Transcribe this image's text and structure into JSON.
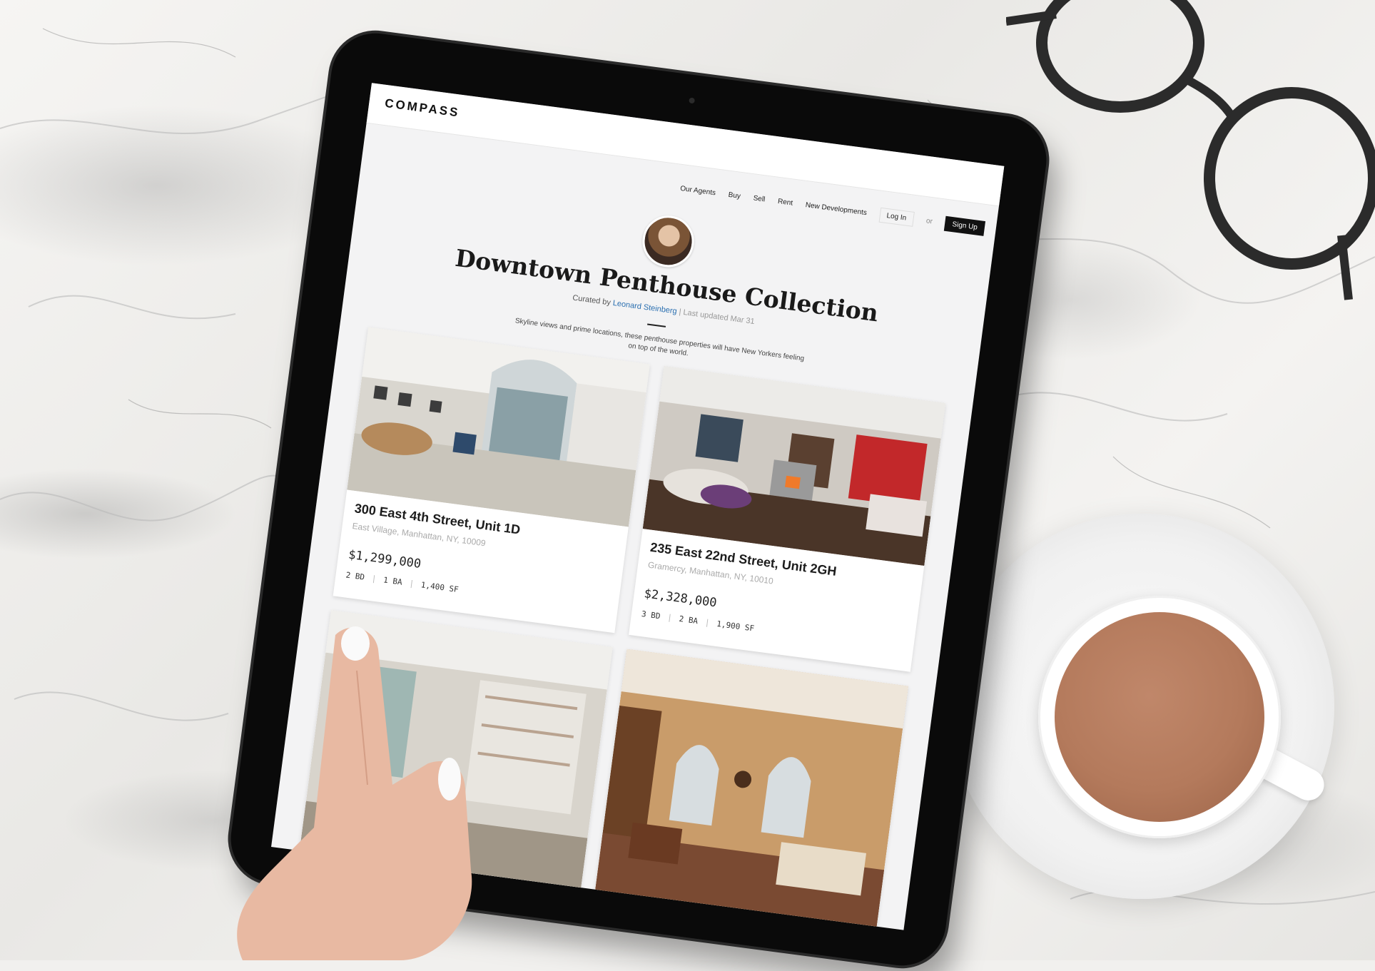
{
  "site": {
    "logo": "COMPASS",
    "nav": [
      "Our Agents",
      "Buy",
      "Sell",
      "Rent",
      "New Developments"
    ],
    "login": "Log In",
    "or": "or",
    "signup": "Sign Up"
  },
  "collection": {
    "title": "Downtown Penthouse Collection",
    "curated_prefix": "Curated by",
    "agent": "Leonard Steinberg",
    "updated": "| Last updated Mar 31",
    "description": "Skyline views and prime locations, these penthouse properties will have New Yorkers feeling on top of the world."
  },
  "listings": [
    {
      "address": "300 East 4th Street, Unit 1D",
      "neighborhood": "East Village, Manhattan, NY, 10009",
      "price": "$1,299,000",
      "beds": "2 BD",
      "baths": "1 BA",
      "sqft": "1,400 SF",
      "spec_sep": "|"
    },
    {
      "address": "235 East 22nd Street, Unit 2GH",
      "neighborhood": "Gramercy, Manhattan, NY, 10010",
      "price": "$2,328,000",
      "beds": "3 BD",
      "baths": "2 BA",
      "sqft": "1,900 SF",
      "spec_sep": "|"
    }
  ],
  "colors": {
    "accent_link": "#2a6fb0",
    "coffee": "#b47a5c",
    "tablet_bezel": "#0a0a0a"
  }
}
